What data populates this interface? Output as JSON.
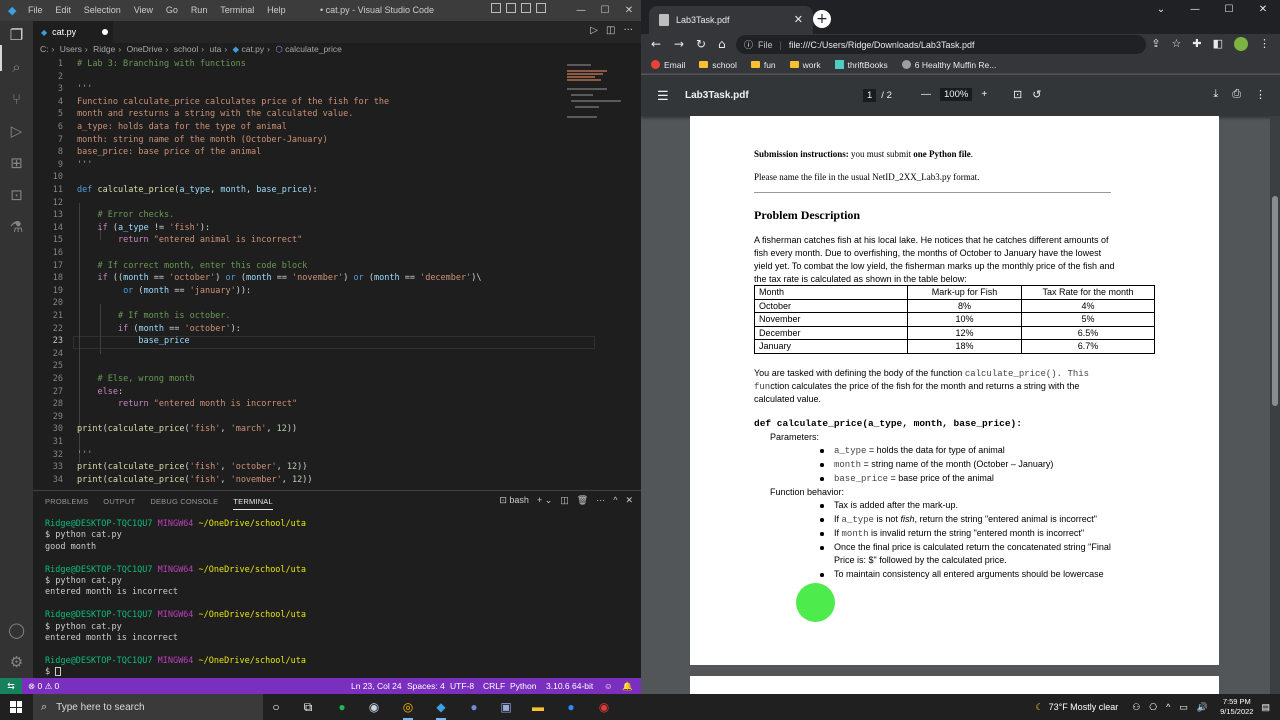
{
  "vscode": {
    "menu": [
      "File",
      "Edit",
      "Selection",
      "View",
      "Go",
      "Run",
      "Terminal",
      "Help"
    ],
    "window_title": "• cat.py - Visual Studio Code",
    "tab": {
      "label": "cat.py"
    },
    "breadcrumb": [
      "C:",
      "Users",
      "Ridge",
      "OneDrive",
      "school",
      "uta",
      "cat.py",
      "calculate_price"
    ],
    "code_lines": [
      {
        "n": "1",
        "html": "<span class='c-com'># Lab 3: Branching with functions</span>"
      },
      {
        "n": "2",
        "html": ""
      },
      {
        "n": "3",
        "html": "<span class='c-doc'>'''</span>"
      },
      {
        "n": "4",
        "html": "<span class='c-doc'>Functino calculate_price calculates price of the fish for the</span>"
      },
      {
        "n": "5",
        "html": "<span class='c-doc'>month and resturns a string with the calculated value.</span>"
      },
      {
        "n": "6",
        "html": "<span class='c-doc'>a_type: holds data for the type of animal</span>"
      },
      {
        "n": "7",
        "html": "<span class='c-doc'>month: string name of the month (October-January)</span>"
      },
      {
        "n": "8",
        "html": "<span class='c-doc'>base_price: base price of the animal</span>"
      },
      {
        "n": "9",
        "html": "<span class='c-doc'>'''</span>"
      },
      {
        "n": "10",
        "html": ""
      },
      {
        "n": "11",
        "html": "<span class='c-kw'>def</span> <span class='c-fn'>calculate_price</span>(<span class='c-var'>a_type</span>, <span class='c-var'>month</span>, <span class='c-var'>base_price</span>):"
      },
      {
        "n": "12",
        "html": ""
      },
      {
        "n": "13",
        "html": "    <span class='c-com'># Error checks.</span>"
      },
      {
        "n": "14",
        "html": "    <span class='c-ctl'>if</span> (<span class='c-var'>a_type</span> != <span class='c-str'>'fish'</span>):"
      },
      {
        "n": "15",
        "html": "        <span class='c-ctl'>return</span> <span class='c-str'>\"entered animal is incorrect\"</span>"
      },
      {
        "n": "16",
        "html": ""
      },
      {
        "n": "17",
        "html": "    <span class='c-com'># If correct month, enter this code block</span>"
      },
      {
        "n": "18",
        "html": "    <span class='c-ctl'>if</span> ((<span class='c-var'>month</span> == <span class='c-str'>'october'</span>) <span class='c-kw'>or</span> (<span class='c-var'>month</span> == <span class='c-str'>'november'</span>) <span class='c-kw'>or</span> (<span class='c-var'>month</span> == <span class='c-str'>'december'</span>)\\"
      },
      {
        "n": "19",
        "html": "         <span class='c-kw'>or</span> (<span class='c-var'>month</span> == <span class='c-str'>'january'</span>)):"
      },
      {
        "n": "20",
        "html": ""
      },
      {
        "n": "21",
        "html": "        <span class='c-com'># If month is october.</span>"
      },
      {
        "n": "22",
        "html": "        <span class='c-ctl'>if</span> (<span class='c-var'>month</span> == <span class='c-str'>'october'</span>):"
      },
      {
        "n": "23",
        "html": "            <span class='c-var'>base_price</span>"
      },
      {
        "n": "24",
        "html": ""
      },
      {
        "n": "25",
        "html": ""
      },
      {
        "n": "26",
        "html": "    <span class='c-com'># Else, wrong month</span>"
      },
      {
        "n": "27",
        "html": "    <span class='c-ctl'>else</span>:"
      },
      {
        "n": "28",
        "html": "        <span class='c-ctl'>return</span> <span class='c-str'>\"entered month is incorrect\"</span>"
      },
      {
        "n": "29",
        "html": ""
      },
      {
        "n": "30",
        "html": "<span class='c-fn'>print</span>(<span class='c-fn'>calculate_price</span>(<span class='c-str'>'fish'</span>, <span class='c-str'>'march'</span>, <span class='c-num'>12</span>))"
      },
      {
        "n": "31",
        "html": ""
      },
      {
        "n": "32",
        "html": "<span class='c-doc'>'''</span>"
      },
      {
        "n": "33",
        "html": "<span class='c-fn'>print</span>(<span class='c-fn'>calculate_price</span>(<span class='c-str'>'fish'</span>, <span class='c-str'>'october'</span>, <span class='c-num'>12</span>))"
      },
      {
        "n": "34",
        "html": "<span class='c-fn'>print</span>(<span class='c-fn'>calculate_price</span>(<span class='c-str'>'fish'</span>, <span class='c-str'>'november'</span>, <span class='c-num'>12</span>))"
      }
    ],
    "panel_tabs": [
      "PROBLEMS",
      "OUTPUT",
      "DEBUG CONSOLE",
      "TERMINAL"
    ],
    "panel_shell": "bash",
    "terminal": [
      {
        "user": "Ridge@DESKTOP-TQC1QU7",
        "host": "MINGW64",
        "path": "~/OneDrive/school/uta"
      },
      {
        "text": "$ python cat.py"
      },
      {
        "text": "good month"
      },
      {
        "text": ""
      },
      {
        "user": "Ridge@DESKTOP-TQC1QU7",
        "host": "MINGW64",
        "path": "~/OneDrive/school/uta"
      },
      {
        "text": "$ python cat.py"
      },
      {
        "text": "entered month is incorrect"
      },
      {
        "text": ""
      },
      {
        "user": "Ridge@DESKTOP-TQC1QU7",
        "host": "MINGW64",
        "path": "~/OneDrive/school/uta"
      },
      {
        "text": "$ python cat.py"
      },
      {
        "text": "entered month is incorrect"
      },
      {
        "text": ""
      },
      {
        "user": "Ridge@DESKTOP-TQC1QU7",
        "host": "MINGW64",
        "path": "~/OneDrive/school/uta"
      },
      {
        "text": "$ ",
        "cursor": true
      }
    ],
    "status": {
      "problems": "⊗ 0 ⚠ 0",
      "position": "Ln 23, Col 24",
      "spaces": "Spaces: 4",
      "encoding": "UTF-8",
      "eol": "CRLF",
      "language": "Python",
      "interpreter": "3.10.6 64-bit"
    }
  },
  "chrome": {
    "tab_title": "Lab3Task.pdf",
    "url_scheme": "File",
    "url": "file:///C:/Users/Ridge/Downloads/Lab3Task.pdf",
    "bookmarks": [
      "Email",
      "school",
      "fun",
      "work",
      "thriftBooks",
      "6 Healthy Muffin Re..."
    ],
    "pdf": {
      "title": "Lab3Task.pdf",
      "page_current": "1",
      "page_total": "/ 2",
      "zoom": "100%"
    }
  },
  "doc": {
    "submission_label": "Submission instructions:",
    "submission_text": " you must submit ",
    "submission_bold": "one Python file",
    "submission_end": ".",
    "naming": "Please name the file in the usual NetID_2XX_Lab3.py format.",
    "heading": "Problem Description",
    "para1": [
      "A fisherman catches fish at his local lake. He notices that he catches different amounts of",
      "fish every month. Due to overfishing, the months of October to January have the lowest",
      "yield yet. To combat the low yield, the fisherman marks up the monthly price of the fish and",
      "the tax rate is calculated as shown in the table below:"
    ],
    "table": {
      "headers": [
        "Month",
        "Mark-up for Fish",
        "Tax Rate for the month"
      ],
      "rows": [
        [
          "October",
          "8%",
          "4%"
        ],
        [
          "November",
          "10%",
          "5%"
        ],
        [
          "December",
          "12%",
          "6.5%"
        ],
        [
          "January",
          "18%",
          "6.7%"
        ]
      ]
    },
    "para2_a": "You are tasked with defining the body of the function ",
    "para2_code": "calculate_price(). This",
    "para2_b_code": "fun",
    "para2_b": "ction calculates the price of the fish for the month and returns a string with the",
    "para2_c": "calculated value.",
    "signature": "def calculate_price(a_type, month, base_price):",
    "params_label": "Parameters:",
    "params": [
      {
        "code": "a_type",
        "text": " = holds the data for type of animal"
      },
      {
        "code": "month",
        "text": " = string name of the month (October – January)"
      },
      {
        "code": "base_price",
        "text": " = base price of the animal"
      }
    ],
    "behavior_label": "Function behavior:",
    "behavior": [
      {
        "text": "Tax is added after the mark-up."
      },
      {
        "pre": "If ",
        "code": "a_type",
        "mid": " is not ",
        "em": "fish",
        "post": ", return the string \"entered animal is incorrect\""
      },
      {
        "pre": "If ",
        "code": "month",
        "post": " is invalid return the string \"entered month is incorrect\""
      },
      {
        "text": "Once the final price is calculated return the concatenated string \"Final",
        "text2": "Price is: $\" followed by the calculated price."
      },
      {
        "text": "To maintain consistency all entered arguments should be lowercase"
      }
    ]
  },
  "taskbar": {
    "search_placeholder": "Type here to search",
    "weather": "73°F  Mostly clear",
    "time": "7:59 PM",
    "date": "9/15/2022"
  },
  "colors": {
    "statusbar": "#7b2fbe",
    "remote": "#16825d",
    "click_indicator": "#2ee82b"
  }
}
